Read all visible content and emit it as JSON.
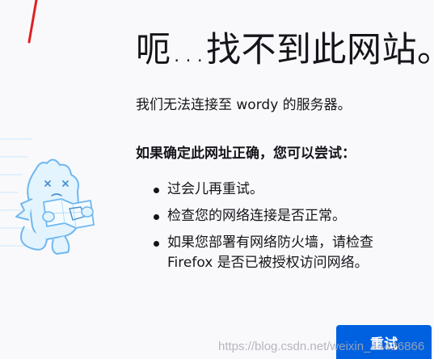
{
  "page": {
    "title": "呃…找不到此网站。",
    "description": "我们无法连接至 wordy 的服务器。",
    "advice_heading": "如果确定此网址正确，您可以尝试：",
    "suggestions": [
      "过会儿再重试。",
      "检查您的网络连接是否正常。",
      "如果您部署有网络防火墙，请检查 Firefox 是否已被授权访问网络。"
    ],
    "retry_label": "重试",
    "watermark": "https://blog.csdn.net/weixin_44426866"
  },
  "colors": {
    "background": "#f9f9fb",
    "text": "#15141a",
    "primary_button": "#0061e0",
    "mascot_fill": "#e3f4ff",
    "mascot_stroke": "#6fb7f0",
    "annotation_red": "#e02020"
  },
  "icons": {
    "mascot": "confused-dinosaur-with-map-icon"
  }
}
